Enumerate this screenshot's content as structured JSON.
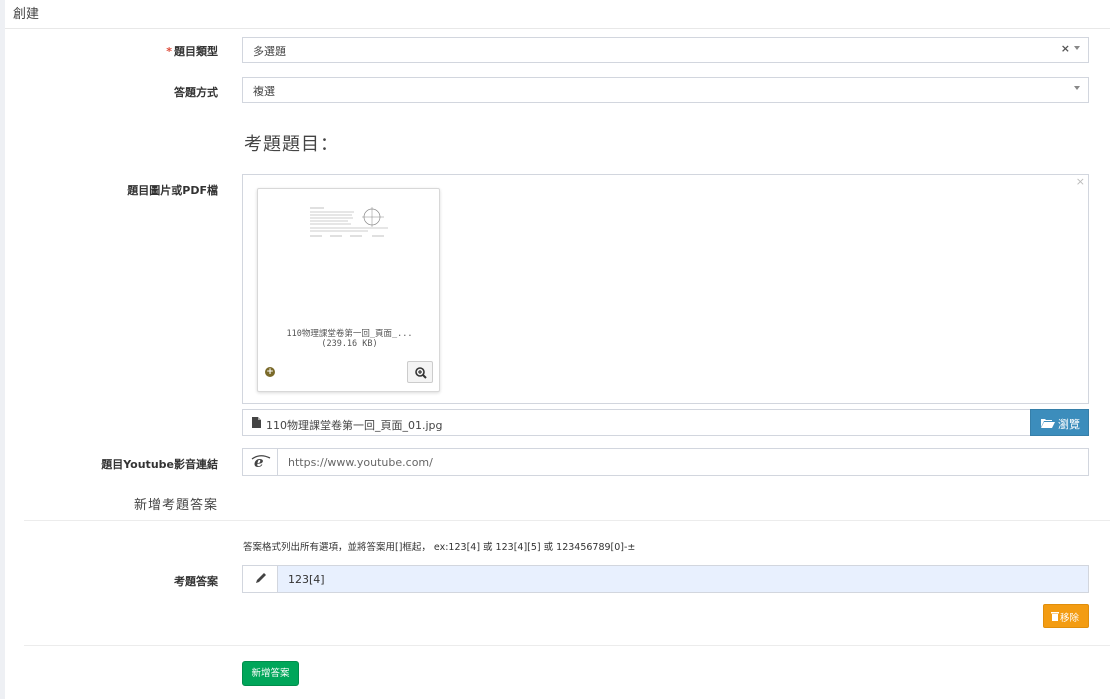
{
  "header": {
    "title": "創建"
  },
  "form": {
    "question_type": {
      "required_mark": "*",
      "label": "題目類型",
      "value": "多選題",
      "clear_glyph": "×"
    },
    "answer_mode": {
      "label": "答題方式",
      "value": "複選"
    },
    "section_title": "考題題目：",
    "image_upload": {
      "label": "題目圖片或PDF檔",
      "preview": {
        "file_name": "110物理課堂卷第一回_頁面_...",
        "file_size": "(239.16 KB)"
      },
      "selected_file": "110物理課堂卷第一回_頁面_01.jpg",
      "browse_label": "瀏覽",
      "dropzone_close": "×"
    },
    "youtube": {
      "label": "題目Youtube影音連結",
      "placeholder": "https://www.youtube.com/"
    }
  },
  "answers": {
    "heading": "新增考題答案",
    "hint": "答案格式列出所有選項，並將答案用[]框起， ex:123[4] 或 123[4][5] 或 123456789[0]-±",
    "answer_label": "考題答案",
    "answer_value": "123[4]",
    "remove_label": "移除",
    "add_label": "新增答案"
  },
  "colors": {
    "primary": "#3c8dbc",
    "warning": "#f39c12",
    "success": "#00a65a",
    "required": "#dd4b39",
    "answer_bg": "#e8f0fe"
  },
  "icons": {
    "file": "file-icon",
    "browse": "folder-open-icon",
    "link": "internet-explorer-icon",
    "answer": "pencil-icon",
    "remove": "trash-icon",
    "zoom": "zoom-in-icon",
    "status": "plus-circle-icon"
  }
}
